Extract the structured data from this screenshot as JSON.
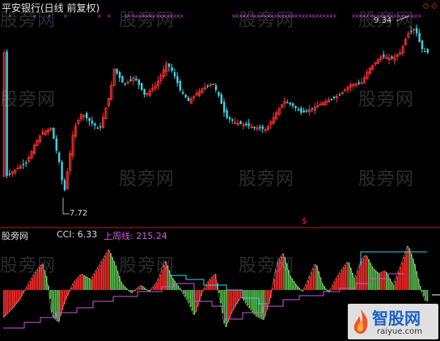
{
  "main_panel": {
    "title": "平安银行(日线 前复权)",
    "high_label": "9.34",
    "low_label": "7.72",
    "window_controls": "◇ ◇"
  },
  "sub_panel": {
    "name": "股旁网",
    "cci_label": "CCI: 6.33",
    "upper_label": "上周线: 215.24",
    "signal_marker": "$"
  },
  "watermarks": [
    "股旁网",
    "股旁网",
    "股旁网",
    "股旁网",
    "股旁网",
    "股旁网",
    "股旁网",
    "股旁网",
    "股旁网",
    "股旁网",
    "股旁网",
    "股旁网"
  ],
  "logo": {
    "main": "智股网",
    "sub": "raiyue.com"
  },
  "colors": {
    "up": "#ff3030",
    "down": "#3ad6e8",
    "upper_line": "#c75cd6",
    "cyan_line": "#3ad6e8",
    "cci_up": "#ff2a2a",
    "cci_down": "#59c24e",
    "marks": "#d040f0"
  }
}
